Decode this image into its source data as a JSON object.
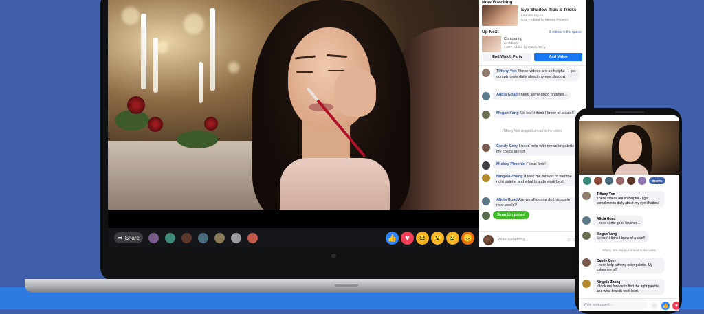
{
  "panel": {
    "now_watching_label": "Now Watching",
    "now_watching": {
      "title": "Eye Shadow Tips & Tricks",
      "author": "Leandro Ogura",
      "meta": "0:05 • Added by Mickey Phoenix"
    },
    "up_next_label": "Up Next",
    "up_next_count": "9 videos in the queue",
    "up_next": {
      "title": "Contouring",
      "author": "Ilo Ribeiro",
      "meta": "4:28 • Added by Candy Grey"
    },
    "end_button": "End Watch Party",
    "add_button": "Add Video",
    "messages": [
      {
        "name": "Tiffany Yen",
        "text": "These videos are so helpful - I get compliments daily about my eye shadow!",
        "color": "#8f7a6c"
      },
      {
        "name": "Alicia Goad",
        "text": "I need some good brushes...",
        "color": "#5d7a8a"
      },
      {
        "name": "Megan Yang",
        "text": "Me too! I think I know of a sale!!",
        "color": "#6a6f52"
      },
      {
        "name": "Candy Grey",
        "text": "I need help with my color palette. My colors are off.",
        "color": "#7a5a4c"
      },
      {
        "name": "Mickey Phoenix",
        "text": "Focus kids!",
        "color": "#3d3f44"
      },
      {
        "name": "Ningxia Zhang",
        "text": "It took me forever to find the right palette and what brands work best.",
        "color": "#b48a2d"
      },
      {
        "name": "Alicia Goad",
        "text": "Are we all gonna do this again next week!?",
        "color": "#5d7a8a"
      }
    ],
    "skipped_note": "Tiffany Yen skipped ahead in the video",
    "joined": "Sean Lin joined",
    "compose_placeholder": "Write something..."
  },
  "video_bar": {
    "share_label": "Share",
    "share_icon": "share-arrow-icon",
    "viewer_colors": [
      "#7b5a8c",
      "#3e8a7a",
      "#5b3a2c",
      "#4a6b7c",
      "#8a7a5a",
      "#9a9aa0",
      "#c25a4a"
    ],
    "reactions": [
      {
        "name": "like-icon",
        "glyph": "👍",
        "color": "#2d86ff"
      },
      {
        "name": "love-icon",
        "glyph": "♥",
        "color": "#f33e58"
      },
      {
        "name": "haha-icon",
        "glyph": "😆",
        "color": "#f7b125"
      },
      {
        "name": "wow-icon",
        "glyph": "😮",
        "color": "#f7b125"
      },
      {
        "name": "sad-icon",
        "glyph": "😢",
        "color": "#f7b125"
      },
      {
        "name": "angry-icon",
        "glyph": "😠",
        "color": "#e9710f"
      }
    ]
  },
  "phone": {
    "invite_label": "INVITE",
    "viewer_colors": [
      "#3e8a7a",
      "#8a4a3c",
      "#4a6b7c",
      "#9a6a6a",
      "#5b3a2c",
      "#8f7ab0"
    ],
    "messages": [
      {
        "name": "Tiffany Yen",
        "text": "These videos are so helpful - I get compliments daily about my eye shadow!",
        "color": "#8f7a6c"
      },
      {
        "name": "Alicia Goad",
        "text": "I need some good brushes...",
        "color": "#5d7a8a"
      },
      {
        "name": "Megan Yang",
        "text": "Me too! I think I know of a sale!!",
        "color": "#6a6f52"
      },
      {
        "name": "Candy Grey",
        "text": "I need help with my color palette. My colors are off.",
        "color": "#7a5a4c"
      },
      {
        "name": "Ningxia Zhang",
        "text": "It took me forever to find the right palette and what brands work best.",
        "color": "#b48a2d"
      }
    ],
    "skipped_note": "Tiffany Yen skipped ahead in the video",
    "compose_placeholder": "Write a comment..."
  }
}
